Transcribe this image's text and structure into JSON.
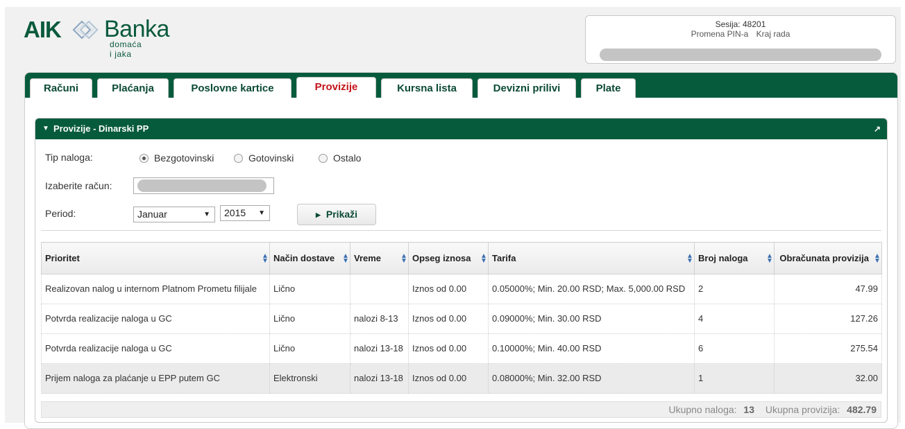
{
  "brand": {
    "name_bold": "AIK",
    "name": "Banka",
    "tagline": "domaća i jaka",
    "color": "#0a5a3c"
  },
  "session": {
    "label": "Sesija:",
    "value": "48201",
    "change_pin": "Promena PIN-a",
    "logout": "Kraj rada"
  },
  "tabs": [
    {
      "label": "Računi",
      "active": false
    },
    {
      "label": "Plaćanja",
      "active": false
    },
    {
      "label": "Poslovne kartice",
      "active": false
    },
    {
      "label": "Provizije",
      "active": true
    },
    {
      "label": "Kursna lista",
      "active": false
    },
    {
      "label": "Devizni prilivi",
      "active": false
    },
    {
      "label": "Plate",
      "active": false
    }
  ],
  "panel": {
    "title": "Provizije - Dinarski PP"
  },
  "form": {
    "tip_label": "Tip naloga:",
    "radios": [
      {
        "label": "Bezgotovinski",
        "checked": true
      },
      {
        "label": "Gotovinski",
        "checked": false
      },
      {
        "label": "Ostalo",
        "checked": false
      }
    ],
    "account_label": "Izaberite račun:",
    "period_label": "Period:",
    "month": "Januar",
    "year": "2015",
    "show_button": "Prikaži"
  },
  "table": {
    "headers": [
      "Prioritet",
      "Način dostave",
      "Vreme",
      "Opseg iznosa",
      "Tarifa",
      "Broj naloga",
      "Obračunata provizija"
    ],
    "rows": [
      [
        "Realizovan nalog u internom Platnom Prometu filijale",
        "Lično",
        "",
        "Iznos od 0.00",
        "0.05000%; Min. 20.00 RSD; Max. 5,000.00 RSD",
        "2",
        "47.99"
      ],
      [
        "Potvrda realizacije naloga u GC",
        "Lično",
        "nalozi 8-13",
        "Iznos od 0.00",
        "0.09000%; Min. 30.00 RSD",
        "4",
        "127.26"
      ],
      [
        "Potvrda realizacije naloga u GC",
        "Lično",
        "nalozi 13-18",
        "Iznos od 0.00",
        "0.10000%; Min. 40.00 RSD",
        "6",
        "275.54"
      ],
      [
        "Prijem naloga za plaćanje u EPP putem GC",
        "Elektronski",
        "nalozi 13-18",
        "Iznos od 0.00",
        "0.08000%; Min. 32.00 RSD",
        "1",
        "32.00"
      ]
    ],
    "highlighted_row": 3
  },
  "totals": {
    "count_label": "Ukupno naloga:",
    "count_value": "13",
    "sum_label": "Ukupna provizija:",
    "sum_value": "482.79"
  },
  "colors": {
    "primary_green": "#075b3d",
    "active_tab_text": "#c3131b"
  },
  "icons": {
    "collapse": "caret-down-icon",
    "expand": "expand-arrow-icon",
    "sort": "sort-icon",
    "button": "play-triangle-icon"
  }
}
